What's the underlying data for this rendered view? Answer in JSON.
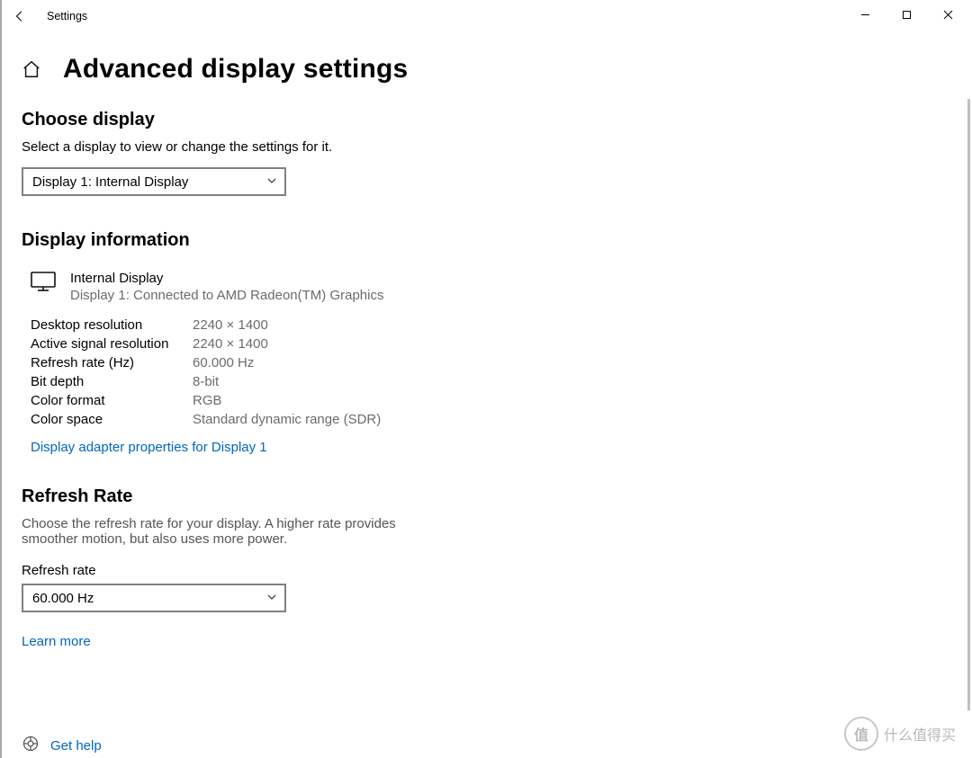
{
  "window": {
    "title": "Settings"
  },
  "page": {
    "title": "Advanced display settings"
  },
  "choose_display": {
    "heading": "Choose display",
    "description": "Select a display to view or change the settings for it.",
    "dropdown_value": "Display 1: Internal Display"
  },
  "display_info": {
    "heading": "Display information",
    "monitor_name": "Internal Display",
    "monitor_sub": "Display 1: Connected to AMD Radeon(TM) Graphics",
    "props": [
      {
        "label": "Desktop resolution",
        "value": "2240 × 1400"
      },
      {
        "label": "Active signal resolution",
        "value": "2240 × 1400"
      },
      {
        "label": "Refresh rate (Hz)",
        "value": "60.000 Hz"
      },
      {
        "label": "Bit depth",
        "value": "8-bit"
      },
      {
        "label": "Color format",
        "value": "RGB"
      },
      {
        "label": "Color space",
        "value": "Standard dynamic range (SDR)"
      }
    ],
    "adapter_link": "Display adapter properties for Display 1"
  },
  "refresh_rate": {
    "heading": "Refresh Rate",
    "description": "Choose the refresh rate for your display. A higher rate provides smoother motion, but also uses more power.",
    "label": "Refresh rate",
    "dropdown_value": "60.000 Hz",
    "learn_more": "Learn more"
  },
  "help": {
    "link": "Get help"
  },
  "watermark": {
    "text": "什么值得买",
    "badge": "值"
  }
}
